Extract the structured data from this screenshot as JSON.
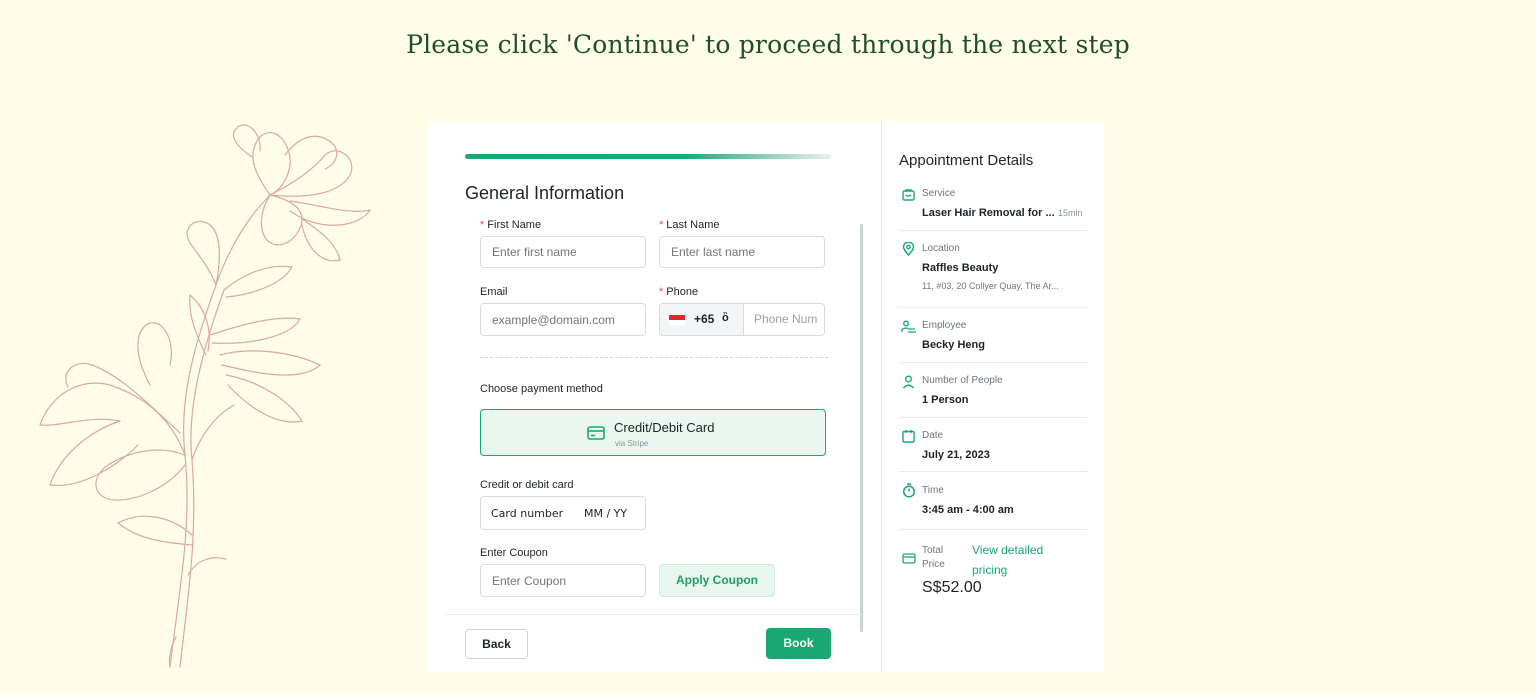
{
  "headline": "Please click 'Continue' to proceed through the next step",
  "form": {
    "title": "General Information",
    "first_name": {
      "label": "First Name",
      "placeholder": "Enter first name"
    },
    "last_name": {
      "label": "Last Name",
      "placeholder": "Enter last name"
    },
    "email": {
      "label": "Email",
      "placeholder": "example@domain.com"
    },
    "phone": {
      "label": "Phone",
      "dial_code": "+65",
      "caret": "ὂ",
      "placeholder": "Phone Num"
    },
    "payment_label": "Choose payment method",
    "payment_option": {
      "title": "Credit/Debit Card",
      "subtitle": "via Stripe"
    },
    "card_label": "Credit or debit card",
    "card_number_placeholder": "Card number",
    "card_expiry_placeholder": "MM / YY",
    "coupon": {
      "label": "Enter Coupon",
      "placeholder": "Enter Coupon",
      "button": "Apply Coupon"
    },
    "back_button": "Back",
    "book_button": "Book"
  },
  "details": {
    "title": "Appointment Details",
    "service": {
      "label": "Service",
      "value": "Laser Hair Removal for ...",
      "duration": "15min"
    },
    "location": {
      "label": "Location",
      "value": "Raffles Beauty",
      "address": "11, #03, 20 Collyer Quay, The Ar..."
    },
    "employee": {
      "label": "Employee",
      "value": "Becky Heng"
    },
    "people": {
      "label": "Number of People",
      "value": "1 Person"
    },
    "date": {
      "label": "Date",
      "value": "July 21, 2023"
    },
    "time": {
      "label": "Time",
      "value": "3:45 am -  4:00 am"
    },
    "price": {
      "label_line1": "Total",
      "label_line2": "Price",
      "link": "View detailed pricing",
      "value": "S$52.00"
    }
  },
  "colors": {
    "accent": "#1aa774",
    "background": "#fffde8",
    "headline": "#1f4f2a",
    "flower_stroke": "#d9a9a0",
    "required": "#e5484d"
  },
  "icons": [
    "flower-illustration",
    "credit-card-icon",
    "service-bag-icon",
    "location-pin-icon",
    "employee-icon",
    "person-icon",
    "calendar-icon",
    "stopwatch-icon",
    "price-card-icon",
    "singapore-flag-icon"
  ]
}
